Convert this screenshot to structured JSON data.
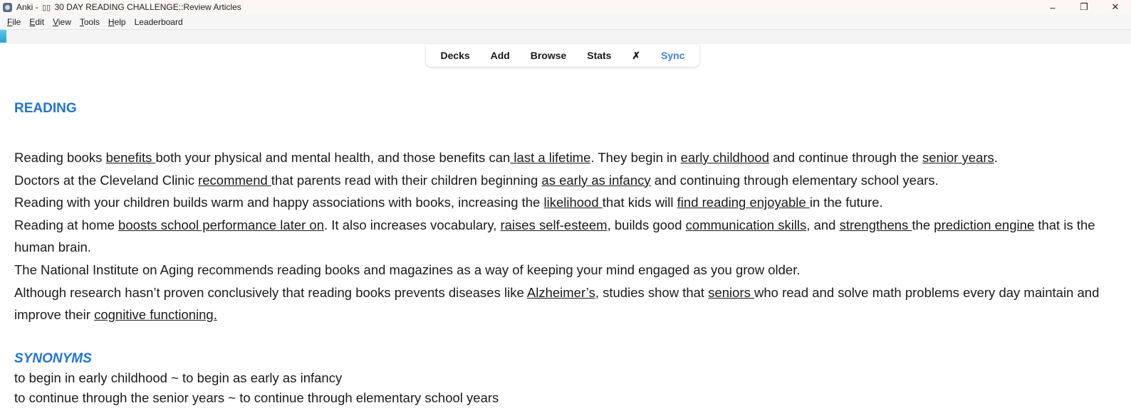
{
  "window": {
    "app_name": "Anki -",
    "deck_title": "30 DAY READING CHALLENGE::Review Articles",
    "controls": {
      "minimize": "–",
      "maximize": "❐",
      "close": "✕"
    }
  },
  "menu": {
    "items": [
      {
        "label": "File",
        "mnemonic_first": "F",
        "rest": "ile"
      },
      {
        "label": "Edit",
        "mnemonic_first": "E",
        "rest": "dit"
      },
      {
        "label": "View",
        "mnemonic_first": "V",
        "rest": "iew"
      },
      {
        "label": "Tools",
        "mnemonic_first": "T",
        "rest": "ools"
      },
      {
        "label": "Help",
        "mnemonic_first": "H",
        "rest": "elp"
      },
      {
        "label": "Leaderboard",
        "mnemonic_first": "",
        "rest": "Leaderboard"
      }
    ]
  },
  "toolbar": {
    "decks": "Decks",
    "add": "Add",
    "browse": "Browse",
    "stats": "Stats",
    "x": "✗",
    "sync": "Sync",
    "sync_color": "#3b82d6"
  },
  "article": {
    "heading": "READING",
    "p1": {
      "t1": "Reading books ",
      "u1": "benefits ",
      "t2": "both your physical and mental health, and those benefits can",
      "u2": " last a lifetime",
      "t3": ". They begin in ",
      "u3": "early childhood",
      "t4": " and continue through the ",
      "u4": "senior years",
      "t5": "."
    },
    "p2": {
      "t1": "Doctors at the Cleveland Clinic ",
      "u1": "recommend ",
      "t2": "that parents read with their children beginning ",
      "u2": "as early as infancy",
      "t3": " and continuing through elementary school years."
    },
    "p3": {
      "t1": "Reading with your children builds warm and happy associations with books, increasing the ",
      "u1": "likelihood ",
      "t2": "that kids will ",
      "u2": "find reading enjoyable ",
      "t3": "in the future."
    },
    "p4": {
      "t1": "Reading at home ",
      "u1": "boosts school performance later on",
      "t2": ". It also increases vocabulary, ",
      "u2": "raises self-esteem",
      "t3": ", builds good ",
      "u3": "communication skills",
      "t4": ", and ",
      "u4": "strengthens ",
      "t5": "the ",
      "u5": "prediction engine",
      "t6": " that is the human brain."
    },
    "p5": "The National Institute on Aging recommends reading books and magazines as a way of keeping your mind engaged as you grow older.",
    "p6": {
      "t1": "Although research hasn’t proven conclusively that reading books prevents diseases like ",
      "u1": "Alzheimer’s",
      "t2": ", studies show that ",
      "u2": "seniors ",
      "t3": "who read and solve math problems every day maintain and improve their ",
      "u3": "cognitive functioning."
    }
  },
  "synonyms": {
    "heading": "SYNONYMS",
    "lines": [
      "to begin in early childhood ~ to begin as early as infancy",
      "to continue through the senior years ~ to continue through elementary school years"
    ]
  },
  "colors": {
    "accent": "#2274d4",
    "progress": "#2aa3cf"
  }
}
